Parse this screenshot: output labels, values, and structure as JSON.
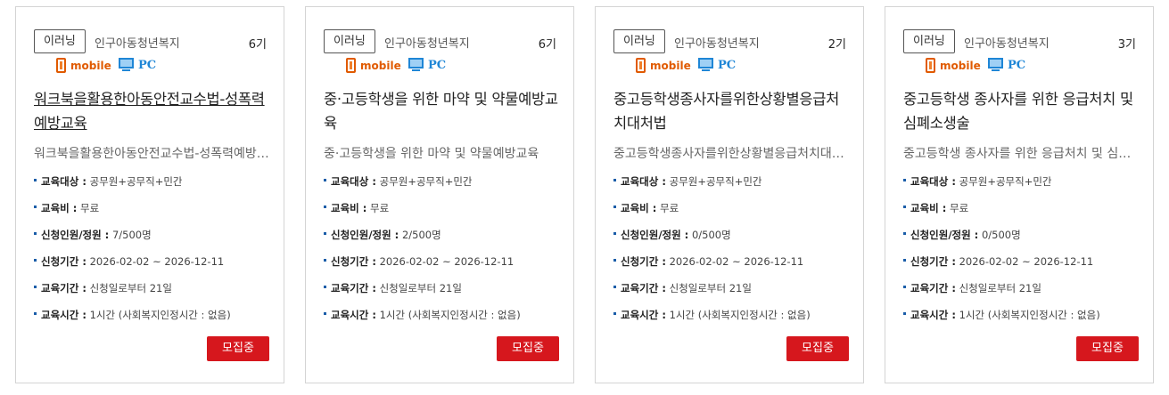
{
  "cards": [
    {
      "badge": "이러닝",
      "category": "인구아동청년복지",
      "round": "6기",
      "mobile_label": "mobile",
      "pc_label": "PC",
      "title": "워크북을활용한아동안전교수법-성폭력예방교육",
      "title_underlined": true,
      "description": "워크북을활용한아동안전교수법-성폭력예방교육",
      "info": {
        "target_label": "교육대상 :",
        "target_value": " 공무원+공무직+민간",
        "fee_label": "교육비 :",
        "fee_value": " 무료",
        "applicants_label": "신청인원/정원 :",
        "applicants_value": " 7/500명",
        "apply_period_label": "신청기간 :",
        "apply_period_value": " 2026-02-02 ~ 2026-12-11",
        "edu_period_label": "교육기간 :",
        "edu_period_value": " 신청일로부터 21일",
        "edu_time_label": "교육시간 :",
        "edu_time_value": " 1시간 (사회복지인정시간 : 없음)"
      },
      "status_button": "모집중"
    },
    {
      "badge": "이러닝",
      "category": "인구아동청년복지",
      "round": "6기",
      "mobile_label": "mobile",
      "pc_label": "PC",
      "title": "중·고등학생을 위한 마약 및 약물예방교육",
      "title_underlined": false,
      "description": "중·고등학생을 위한 마약 및 약물예방교육",
      "info": {
        "target_label": "교육대상 :",
        "target_value": " 공무원+공무직+민간",
        "fee_label": "교육비 :",
        "fee_value": " 무료",
        "applicants_label": "신청인원/정원 :",
        "applicants_value": " 2/500명",
        "apply_period_label": "신청기간 :",
        "apply_period_value": " 2026-02-02 ~ 2026-12-11",
        "edu_period_label": "교육기간 :",
        "edu_period_value": " 신청일로부터 21일",
        "edu_time_label": "교육시간 :",
        "edu_time_value": " 1시간 (사회복지인정시간 : 없음)"
      },
      "status_button": "모집중"
    },
    {
      "badge": "이러닝",
      "category": "인구아동청년복지",
      "round": "2기",
      "mobile_label": "mobile",
      "pc_label": "PC",
      "title": "중고등학생종사자를위한상황별응급처치대처법",
      "title_underlined": false,
      "description": "중고등학생종사자를위한상황별응급처치대처법",
      "info": {
        "target_label": "교육대상 :",
        "target_value": " 공무원+공무직+민간",
        "fee_label": "교육비 :",
        "fee_value": " 무료",
        "applicants_label": "신청인원/정원 :",
        "applicants_value": " 0/500명",
        "apply_period_label": "신청기간 :",
        "apply_period_value": " 2026-02-02 ~ 2026-12-11",
        "edu_period_label": "교육기간 :",
        "edu_period_value": " 신청일로부터 21일",
        "edu_time_label": "교육시간 :",
        "edu_time_value": " 1시간 (사회복지인정시간 : 없음)"
      },
      "status_button": "모집중"
    },
    {
      "badge": "이러닝",
      "category": "인구아동청년복지",
      "round": "3기",
      "mobile_label": "mobile",
      "pc_label": "PC",
      "title": "중고등학생 종사자를 위한 응급처치 및 심폐소생술",
      "title_underlined": false,
      "description": "중고등학생 종사자를 위한 응급처치 및 심폐소생술",
      "info": {
        "target_label": "교육대상 :",
        "target_value": " 공무원+공무직+민간",
        "fee_label": "교육비 :",
        "fee_value": " 무료",
        "applicants_label": "신청인원/정원 :",
        "applicants_value": " 0/500명",
        "apply_period_label": "신청기간 :",
        "apply_period_value": " 2026-02-02 ~ 2026-12-11",
        "edu_period_label": "교육기간 :",
        "edu_period_value": " 신청일로부터 21일",
        "edu_time_label": "교육시간 :",
        "edu_time_value": " 1시간 (사회복지인정시간 : 없음)"
      },
      "status_button": "모집중"
    }
  ],
  "colors": {
    "status_button": "#d6171d",
    "mobile": "#e05a00",
    "pc": "#1f86d6",
    "bullet": "#1a5da8"
  },
  "icons": {
    "mobile": "mobile-phone-icon",
    "pc": "pc-monitor-icon"
  }
}
